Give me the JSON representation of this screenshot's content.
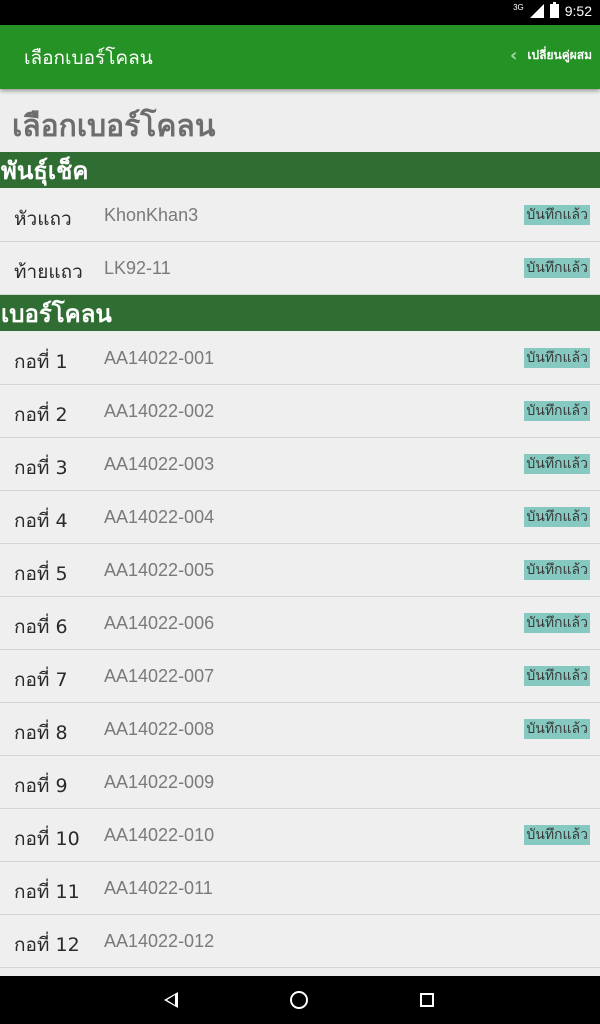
{
  "status_bar": {
    "network": "3G",
    "time": "9:52"
  },
  "app_bar": {
    "title": "เลือกเบอร์โคลน",
    "switch_label": "เปลี่ยนคู่ผสม"
  },
  "page_title": "เลือกเบอร์โคลน",
  "check_section": {
    "header": "พันธุ์เช็ค",
    "rows": [
      {
        "label": "หัวแถว",
        "value": "KhonKhan3",
        "badge": "บันทึกแล้ว"
      },
      {
        "label": "ท้ายแถว",
        "value": "LK92-11",
        "badge": "บันทึกแล้ว"
      }
    ]
  },
  "clone_section": {
    "header": "เบอร์โคลน",
    "rows": [
      {
        "label": "กอที่ 1",
        "value": "AA14022-001",
        "badge": "บันทึกแล้ว"
      },
      {
        "label": "กอที่ 2",
        "value": "AA14022-002",
        "badge": "บันทึกแล้ว"
      },
      {
        "label": "กอที่ 3",
        "value": "AA14022-003",
        "badge": "บันทึกแล้ว"
      },
      {
        "label": "กอที่ 4",
        "value": "AA14022-004",
        "badge": "บันทึกแล้ว"
      },
      {
        "label": "กอที่ 5",
        "value": "AA14022-005",
        "badge": "บันทึกแล้ว"
      },
      {
        "label": "กอที่ 6",
        "value": "AA14022-006",
        "badge": "บันทึกแล้ว"
      },
      {
        "label": "กอที่ 7",
        "value": "AA14022-007",
        "badge": "บันทึกแล้ว"
      },
      {
        "label": "กอที่ 8",
        "value": "AA14022-008",
        "badge": "บันทึกแล้ว"
      },
      {
        "label": "กอที่ 9",
        "value": "AA14022-009",
        "badge": ""
      },
      {
        "label": "กอที่ 10",
        "value": "AA14022-010",
        "badge": "บันทึกแล้ว"
      },
      {
        "label": "กอที่ 11",
        "value": "AA14022-011",
        "badge": ""
      },
      {
        "label": "กอที่ 12",
        "value": "AA14022-012",
        "badge": ""
      }
    ]
  },
  "icons": {
    "switch": "chevron-left-icon",
    "nav_back": "back-icon",
    "nav_home": "home-icon",
    "nav_recents": "recents-icon"
  },
  "colors": {
    "app_bar": "#259225",
    "section_header": "#2f6d33",
    "badge": "#86c9c0"
  }
}
